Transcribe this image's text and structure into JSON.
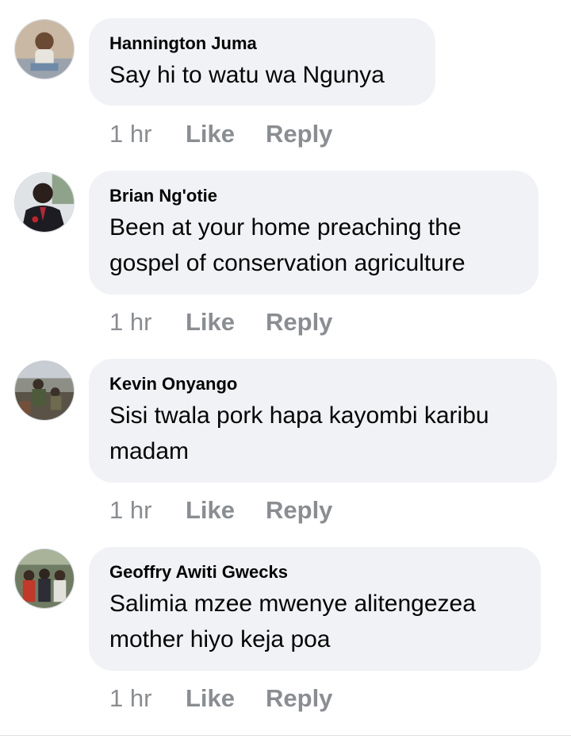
{
  "comments": [
    {
      "author": "Hannington Juma",
      "text": "Say hi to watu wa Ngunya",
      "time": "1 hr",
      "like": "Like",
      "reply": "Reply"
    },
    {
      "author": "Brian Ng'otie",
      "text": "Been at your home preaching the gospel of conservation agriculture",
      "time": "1 hr",
      "like": "Like",
      "reply": "Reply"
    },
    {
      "author": "Kevin Onyango",
      "text": "Sisi twala pork hapa kayombi karibu madam",
      "time": "1 hr",
      "like": "Like",
      "reply": "Reply"
    },
    {
      "author": "Geoffry Awiti Gwecks",
      "text": "Salimia mzee mwenye alitengezea mother hiyo keja poa",
      "time": "1 hr",
      "like": "Like",
      "reply": "Reply"
    }
  ],
  "colors": {
    "bubble": "#f0f2f5",
    "meta_text": "#8a8d91",
    "author_text": "#050505"
  }
}
